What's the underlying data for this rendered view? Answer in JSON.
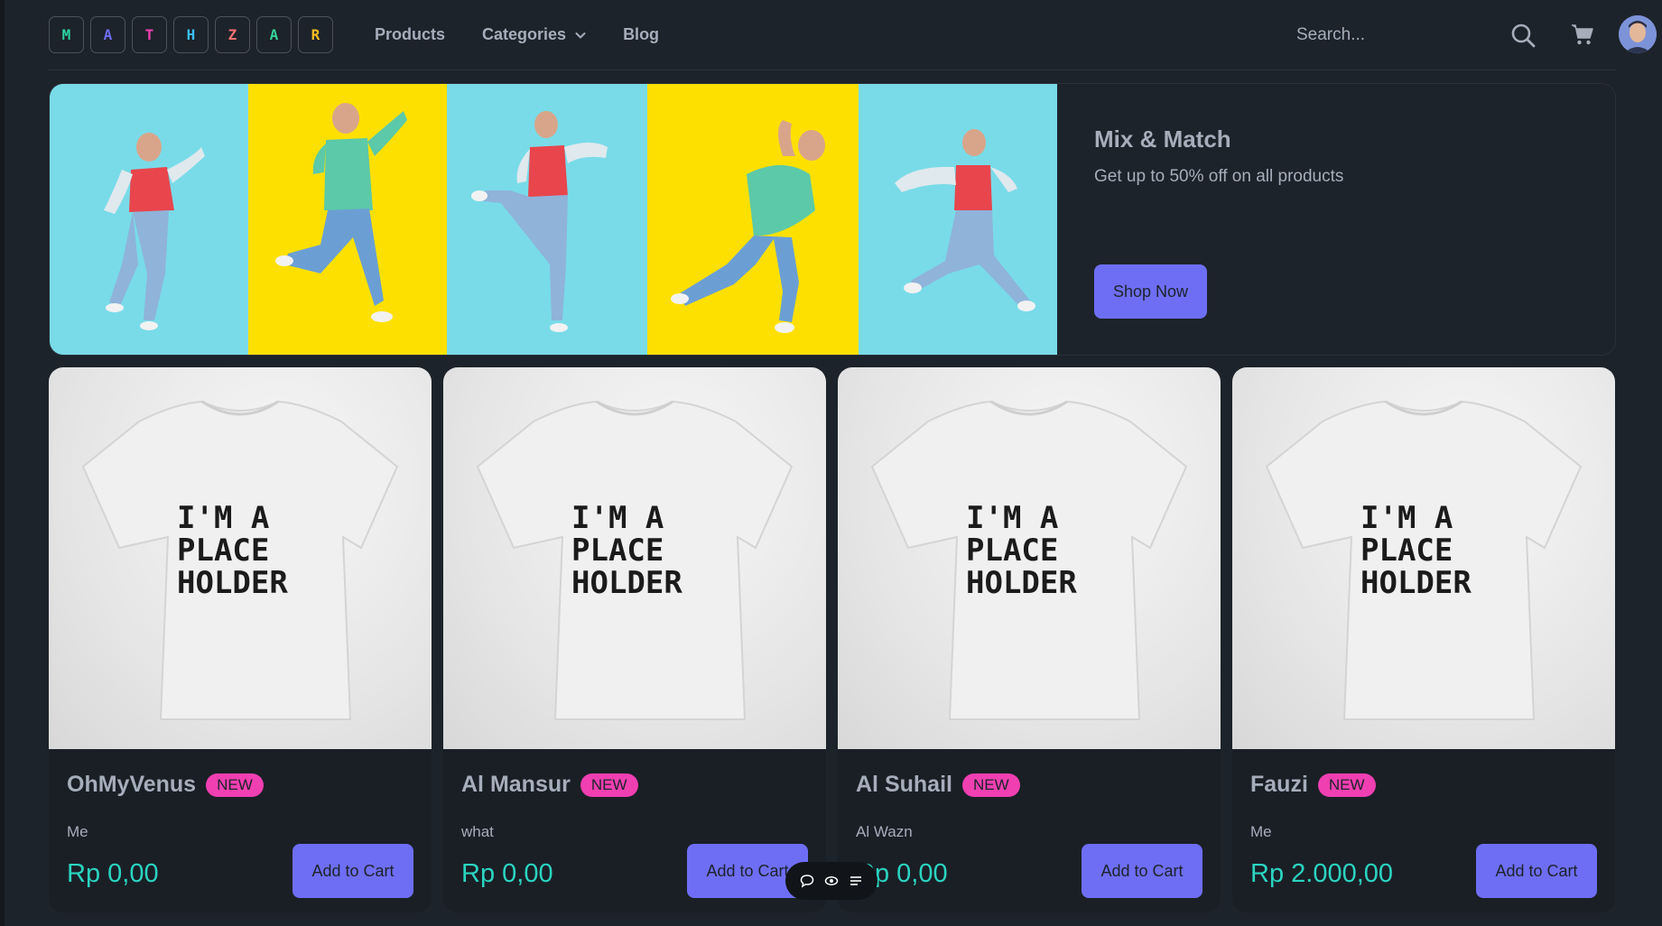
{
  "logo": {
    "letters": [
      {
        "char": "M",
        "color": "#2bd4a4"
      },
      {
        "char": "A",
        "color": "#6e6ef5"
      },
      {
        "char": "T",
        "color": "#f03fb1"
      },
      {
        "char": "H",
        "color": "#3abff8"
      },
      {
        "char": "Z",
        "color": "#f87272"
      },
      {
        "char": "A",
        "color": "#36d399"
      },
      {
        "char": "R",
        "color": "#fbbd23"
      }
    ]
  },
  "nav": {
    "products": "Products",
    "categories": "Categories",
    "blog": "Blog"
  },
  "search": {
    "placeholder": "Search..."
  },
  "hero": {
    "title": "Mix & Match",
    "subtitle": "Get up to 50% off on all products",
    "cta": "Shop Now"
  },
  "products": [
    {
      "name": "OhMyVenus",
      "badge": "NEW",
      "description": "Me",
      "price": "Rp 0,00",
      "cta": "Add to Cart"
    },
    {
      "name": "Al Mansur",
      "badge": "NEW",
      "description": "what",
      "price": "Rp 0,00",
      "cta": "Add to Cart"
    },
    {
      "name": "Al Suhail",
      "badge": "NEW",
      "description": "Al Wazn",
      "price": "Rp 0,00",
      "cta": "Add to Cart"
    },
    {
      "name": "Fauzi",
      "badge": "NEW",
      "description": "Me",
      "price": "Rp 2.000,00",
      "cta": "Add to Cart"
    }
  ],
  "placeholder_text": [
    "I'M A",
    "PLACE",
    "HOLDER"
  ],
  "colors": {
    "background": "#1d232a",
    "primary": "#6e6ef5",
    "secondary": "#f03fb1",
    "accent": "#2bd4c0"
  }
}
